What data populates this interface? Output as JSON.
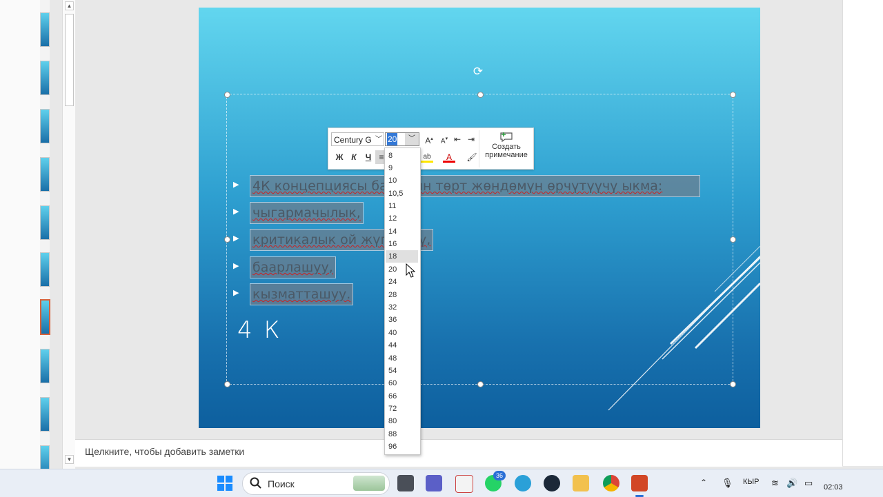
{
  "notes": {
    "placeholder": "Щелкните, чтобы добавить заметки"
  },
  "slide": {
    "bullets": [
      "4К концепциясы баланын төрт жөндөмүн өрчүтүүчү ыкма:",
      "чыгармачылык,",
      "критикалык ой жүгүртүү,",
      "баарлашуу,",
      "кызматташуу."
    ],
    "title": "4 К"
  },
  "mini_toolbar": {
    "font_name": "Century G",
    "font_size": "20",
    "bold_label": "Ж",
    "italic_label": "К",
    "underline_label": "Ч",
    "comment_line1": "Создать",
    "comment_line2": "примечание"
  },
  "size_dropdown": {
    "options": [
      "8",
      "9",
      "10",
      "10,5",
      "11",
      "12",
      "14",
      "16",
      "18",
      "20",
      "24",
      "28",
      "32",
      "36",
      "40",
      "44",
      "48",
      "54",
      "60",
      "66",
      "72",
      "80",
      "88",
      "96"
    ],
    "highlighted": "18"
  },
  "taskbar": {
    "search_placeholder": "Поиск",
    "whatsapp_badge": "36",
    "language": "КЫР",
    "time": "02:03"
  },
  "colors": {
    "slide_top": "#62d6ef",
    "slide_bottom": "#0d5f9e",
    "selection_active": "#d9623a",
    "size_highlight": "#3378d6"
  }
}
